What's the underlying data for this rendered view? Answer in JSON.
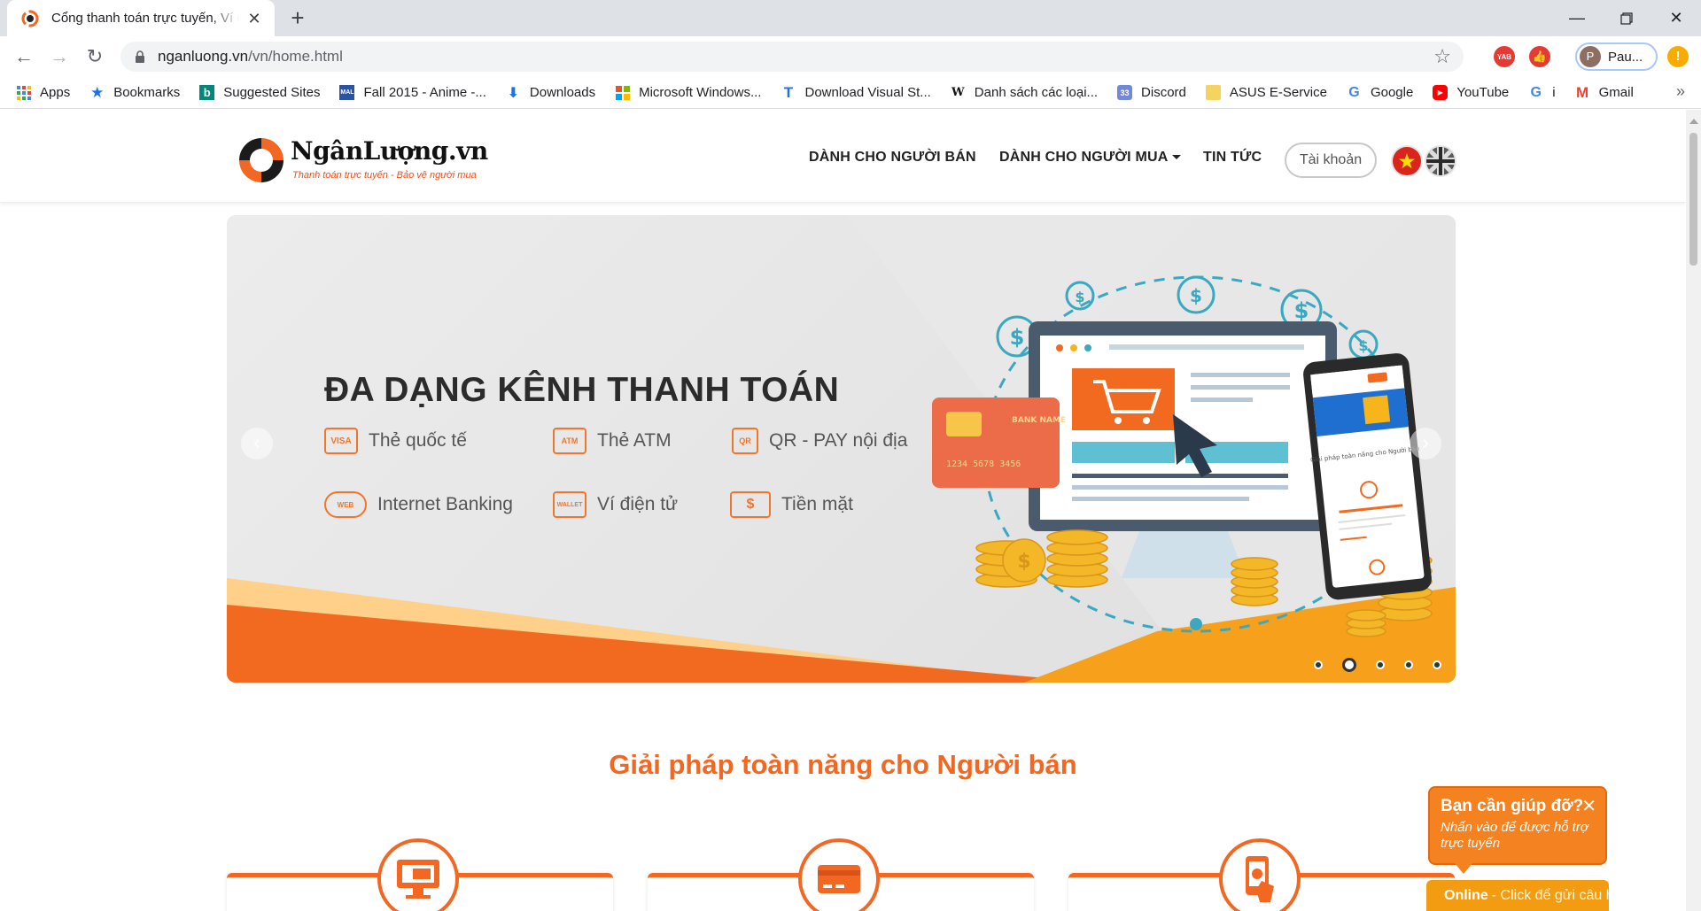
{
  "browser": {
    "tab_title": "Cổng thanh toán trực tuyến, Ví điện tử",
    "url_host": "nganluong.vn",
    "url_path": "/vn/home.html",
    "profile_name": "Pau...",
    "profile_initial": "P",
    "update_badge": "!",
    "ext_yab": "YAB"
  },
  "bookmarks": [
    {
      "label": "Apps",
      "icon": "apps-grid-icon"
    },
    {
      "label": "Bookmarks",
      "icon": "star-icon"
    },
    {
      "label": "Suggested Sites",
      "icon": "bing-icon"
    },
    {
      "label": "Fall 2015 - Anime -...",
      "icon": "mal-icon"
    },
    {
      "label": "Downloads",
      "icon": "download-icon"
    },
    {
      "label": "Microsoft Windows...",
      "icon": "windows-icon"
    },
    {
      "label": "Download Visual St...",
      "icon": "visual-studio-icon"
    },
    {
      "label": "Danh sách các loại...",
      "icon": "wikipedia-icon"
    },
    {
      "label": "Discord",
      "icon": "discord-icon"
    },
    {
      "label": "ASUS E-Service",
      "icon": "folder-icon"
    },
    {
      "label": "Google",
      "icon": "google-icon"
    },
    {
      "label": "YouTube",
      "icon": "youtube-icon"
    },
    {
      "label": "i",
      "icon": "google-icon"
    },
    {
      "label": "Gmail",
      "icon": "gmail-icon"
    }
  ],
  "site": {
    "logo_text": "NgânLượng.vn",
    "logo_tagline": "Thanh toán trực tuyến - Bảo vệ người mua",
    "nav": {
      "sellers": "DÀNH CHO NGƯỜI BÁN",
      "buyers": "DÀNH CHO NGƯỜI MUA",
      "news": "TIN TỨC",
      "account": "Tài khoản"
    },
    "hero": {
      "title": "ĐA DẠNG KÊNH THANH TOÁN",
      "card_text": "BANK NAME",
      "card_number": "1234  5678  3456",
      "phone_caption": "Giải pháp toàn năng cho Người bán",
      "items": [
        {
          "label": "Thẻ quốc tế",
          "icon": "VISA"
        },
        {
          "label": "Thẻ ATM",
          "icon": "ATM"
        },
        {
          "label": "QR - PAY nội địa",
          "icon": "QR"
        },
        {
          "label": "Internet Banking",
          "icon": "WEB"
        },
        {
          "label": "Ví điện tử",
          "icon": "WALLET"
        },
        {
          "label": "Tiền mặt",
          "icon": "$"
        }
      ],
      "active_slide": 2,
      "slide_count": 5
    },
    "section_title": "Giải pháp toàn năng cho Người bán",
    "chat": {
      "title": "Bạn cần giúp đỡ?",
      "subtitle": "Nhấn vào để được hỗ trợ trực tuyến",
      "status": "Online",
      "status_text": "- Click để gửi câu hỏi",
      "close": "✕"
    }
  },
  "colors": {
    "brand_orange": "#f26722",
    "chat_orange": "#f58220",
    "tab_strip": "#dee1e6"
  }
}
